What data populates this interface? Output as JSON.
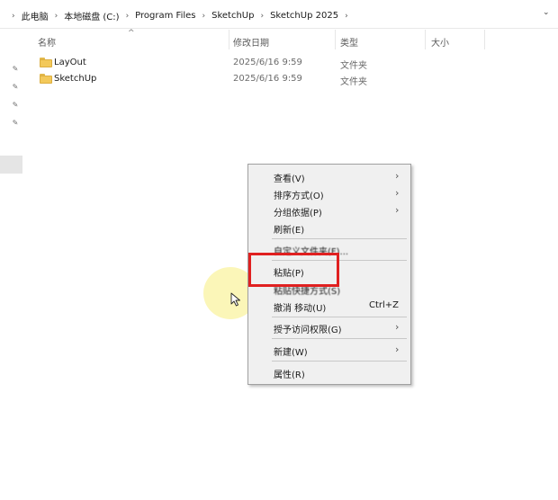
{
  "breadcrumb": {
    "items": [
      "此电脑",
      "本地磁盘 (C:)",
      "Program Files",
      "SketchUp",
      "SketchUp 2025"
    ]
  },
  "columns": {
    "name": "名称",
    "modified": "修改日期",
    "type": "类型",
    "size": "大小"
  },
  "files": [
    {
      "name": "LayOut",
      "modified": "2025/6/16 9:59",
      "type": "文件夹"
    },
    {
      "name": "SketchUp",
      "modified": "2025/6/16 9:59",
      "type": "文件夹"
    }
  ],
  "context_menu": {
    "view": "查看(V)",
    "sort": "排序方式(O)",
    "group": "分组依据(P)",
    "refresh": "刷新(E)",
    "customize": "自定义文件夹(F)...",
    "paste": "粘贴(P)",
    "paste_shortcut": "粘贴快捷方式(S)",
    "undo": "撤消 移动(U)",
    "undo_shortcut": "Ctrl+Z",
    "grant_access": "授予访问权限(G)",
    "new": "新建(W)",
    "properties": "属性(R)"
  },
  "colors": {
    "highlight_box": "#e02020",
    "folder": "#f3c95a",
    "cursor_glow": "#faf3a0"
  }
}
